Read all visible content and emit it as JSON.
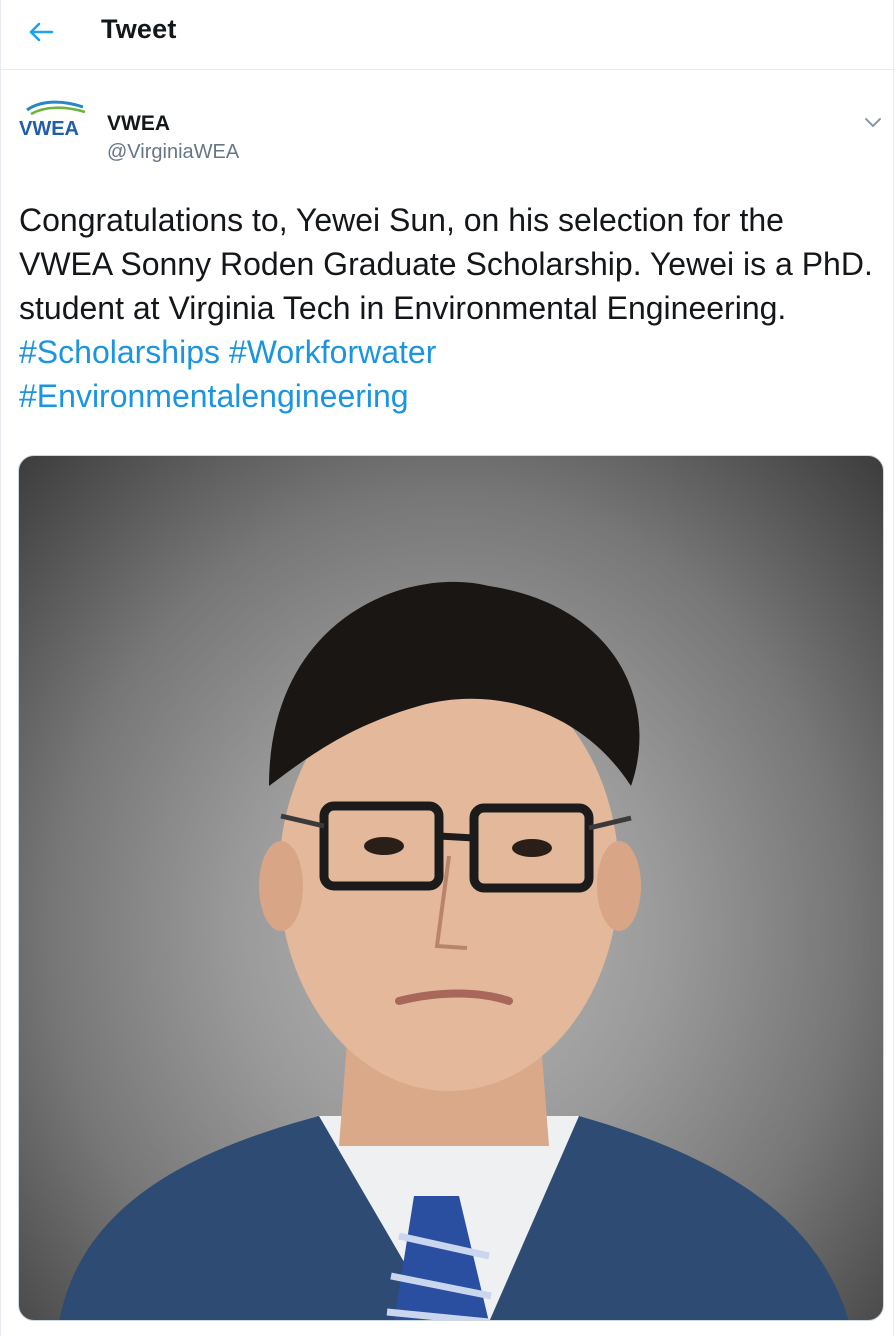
{
  "header": {
    "title": "Tweet",
    "back_icon": "arrow-left-icon"
  },
  "author": {
    "logo_text": "VWEA",
    "name": "VWEA",
    "handle": "@VirginiaWEA"
  },
  "tweet": {
    "text_parts": [
      "Congratulations to, Yewei Sun, on his selection for the VWEA Sonny Roden Graduate Scholarship.   Yewei is a PhD. student at Virginia Tech in Environmental Engineering.  "
    ],
    "hashtags": [
      "#Scholarships",
      "#Workforwater",
      "#Environmentalengineering"
    ]
  },
  "colors": {
    "accent": "#1b95e0",
    "text": "#14171a",
    "secondary": "#657786",
    "border": "#e6ecf0"
  }
}
